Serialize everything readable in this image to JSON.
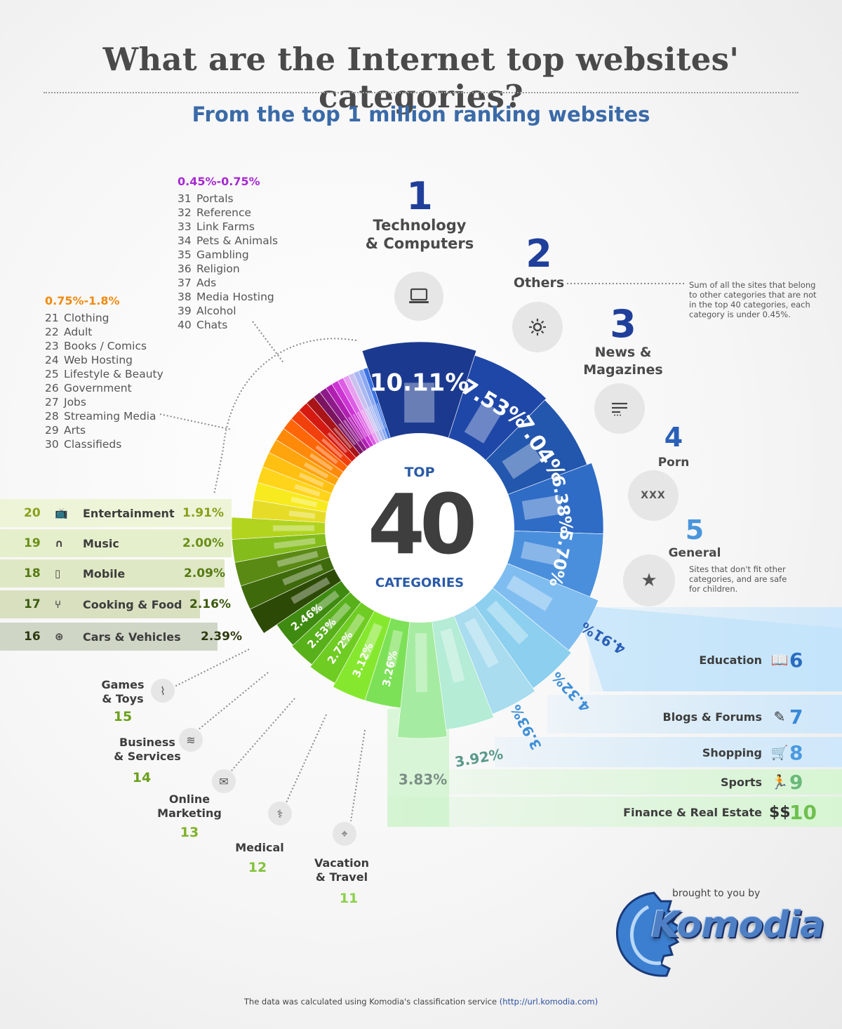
{
  "title": "What are the Internet top websites' categories?",
  "subtitle": "From the top 1 million ranking websites",
  "center": {
    "top": "TOP",
    "number": "40",
    "bottom": "CATEGORIES"
  },
  "top5": [
    {
      "rank": "1",
      "label_lines": [
        "Technology",
        "& Computers"
      ],
      "icon": "laptop-icon"
    },
    {
      "rank": "2",
      "label_lines": [
        "Others"
      ],
      "icon": "gear-icon",
      "note_lines": [
        "Sum of all the sites that belong",
        "to other categories that are not",
        "in the top 40 categories, each",
        "category is under 0.45%."
      ]
    },
    {
      "rank": "3",
      "label_lines": [
        "News &",
        "Magazines"
      ],
      "icon": "lines-icon"
    },
    {
      "rank": "4",
      "label_lines": [
        "Porn"
      ],
      "icon": "xxx-icon",
      "icon_text": "XXX"
    },
    {
      "rank": "5",
      "label_lines": [
        "General"
      ],
      "icon": "star-icon",
      "note_lines": [
        "Sites that don't fit  other",
        "categories, and are safe",
        "for children."
      ]
    }
  ],
  "right_bands": [
    {
      "rank": "6",
      "label": "Education",
      "icon": "book-icon"
    },
    {
      "rank": "7",
      "label": "Blogs & Forums",
      "icon": "pen-icon"
    },
    {
      "rank": "8",
      "label": "Shopping",
      "icon": "cart-icon"
    },
    {
      "rank": "9",
      "label": "Sports",
      "icon": "runner-icon"
    },
    {
      "rank": "10",
      "label": "Finance & Real Estate",
      "icon": "dollar-icon",
      "icon_text": "$$"
    }
  ],
  "left_bands": [
    {
      "rank": "20",
      "label": "Entertainment",
      "value": "1.91%",
      "icon": "tv-icon"
    },
    {
      "rank": "19",
      "label": "Music",
      "value": "2.00%",
      "icon": "headphones-icon"
    },
    {
      "rank": "18",
      "label": "Mobile",
      "value": "2.09%",
      "icon": "phone-icon"
    },
    {
      "rank": "17",
      "label": "Cooking & Food",
      "value": "2.16%",
      "icon": "utensils-icon"
    },
    {
      "rank": "16",
      "label": "Cars & Vehicles",
      "value": "2.39%",
      "icon": "wheel-icon"
    }
  ],
  "small_cats": [
    {
      "rank": "15",
      "label_lines": [
        "Games",
        "& Toys"
      ],
      "icon": "controller-icon"
    },
    {
      "rank": "14",
      "label_lines": [
        "Business",
        "& Services"
      ],
      "icon": "coins-icon"
    },
    {
      "rank": "13",
      "label_lines": [
        "Online",
        "Marketing"
      ],
      "icon": "mail-icon"
    },
    {
      "rank": "12",
      "label_lines": [
        "Medical"
      ],
      "icon": "caduceus-icon"
    },
    {
      "rank": "11",
      "label_lines": [
        "Vacation",
        "& Travel"
      ],
      "icon": "pin-icon"
    }
  ],
  "range_groups": [
    {
      "title": "0.75%-1.8%",
      "color": "#f08a10",
      "items": [
        [
          "21",
          "Clothing"
        ],
        [
          "22",
          "Adult"
        ],
        [
          "23",
          "Books / Comics"
        ],
        [
          "24",
          "Web Hosting"
        ],
        [
          "25",
          "Lifestyle & Beauty"
        ],
        [
          "26",
          "Government"
        ],
        [
          "27",
          "Jobs"
        ],
        [
          "28",
          "Streaming Media"
        ],
        [
          "29",
          "Arts"
        ],
        [
          "30",
          "Classifieds"
        ]
      ]
    },
    {
      "title": "0.45%-0.75%",
      "color": "#a62ad0",
      "items": [
        [
          "31",
          "Portals"
        ],
        [
          "32",
          "Reference"
        ],
        [
          "33",
          "Link Farms"
        ],
        [
          "34",
          "Pets & Animals"
        ],
        [
          "35",
          "Gambling"
        ],
        [
          "36",
          "Religion"
        ],
        [
          "37",
          "Ads"
        ],
        [
          "38",
          "Media Hosting"
        ],
        [
          "39",
          "Alcohol"
        ],
        [
          "40",
          "Chats"
        ]
      ]
    }
  ],
  "brand": {
    "brought": "brought to you by",
    "name": "Komodia"
  },
  "footer": {
    "text": "The data was calculated using Komodia's classification service ",
    "link": "(http://url.komodia.com)"
  },
  "chart_data": {
    "type": "pie",
    "title": "What are the Internet top websites' categories?",
    "subtitle": "From the top 1 million ranking websites",
    "slices": [
      {
        "rank": 1,
        "label": "Technology & Computers",
        "value": 10.11,
        "value_label": "10.11%",
        "color": "#1b3a8f"
      },
      {
        "rank": 2,
        "label": "Others",
        "value": 7.53,
        "value_label": "7.53%",
        "color": "#1f47a8"
      },
      {
        "rank": 3,
        "label": "News & Magazines",
        "value": 7.04,
        "value_label": "7.04%",
        "color": "#2356ad"
      },
      {
        "rank": 4,
        "label": "Porn",
        "value": 6.38,
        "value_label": "6.38%",
        "color": "#2f6cc6"
      },
      {
        "rank": 5,
        "label": "General",
        "value": 5.7,
        "value_label": "5.70%",
        "color": "#4a8fdc"
      },
      {
        "rank": 6,
        "label": "Education",
        "value": 4.91,
        "value_label": "4.91%",
        "color": "#7fbdf0"
      },
      {
        "rank": 7,
        "label": "Blogs & Forums",
        "value": 4.32,
        "value_label": "4.32%",
        "color": "#8ccfee"
      },
      {
        "rank": 8,
        "label": "Shopping",
        "value": 3.93,
        "value_label": "3.93%",
        "color": "#a8dcee"
      },
      {
        "rank": 9,
        "label": "Sports",
        "value": 3.92,
        "value_label": "3.92%",
        "color": "#b4ecd6"
      },
      {
        "rank": 10,
        "label": "Finance & Real Estate",
        "value": 3.83,
        "value_label": "3.83%",
        "color": "#a6eba2"
      },
      {
        "rank": 11,
        "label": "Vacation & Travel",
        "value": 3.26,
        "value_label": "3.26%",
        "color": "#7de158"
      },
      {
        "rank": 12,
        "label": "Medical",
        "value": 3.12,
        "value_label": "3.12%",
        "color": "#86e82e"
      },
      {
        "rank": 13,
        "label": "Online Marketing",
        "value": 2.72,
        "value_label": "2.72%",
        "color": "#6fcc22"
      },
      {
        "rank": 14,
        "label": "Business & Services",
        "value": 2.53,
        "value_label": "2.53%",
        "color": "#58b01b"
      },
      {
        "rank": 15,
        "label": "Games & Toys",
        "value": 2.46,
        "value_label": "2.46%",
        "color": "#3f8a10"
      },
      {
        "rank": 16,
        "label": "Cars & Vehicles",
        "value": 2.39,
        "value_label": "2.39%",
        "color": "#2c4a06"
      },
      {
        "rank": 17,
        "label": "Cooking & Food",
        "value": 2.16,
        "value_label": "2.16%",
        "color": "#3f6a0c"
      },
      {
        "rank": 18,
        "label": "Mobile",
        "value": 2.09,
        "value_label": "2.09%",
        "color": "#5a8a14"
      },
      {
        "rank": 19,
        "label": "Music",
        "value": 2.0,
        "value_label": "2.00%",
        "color": "#84bc1c"
      },
      {
        "rank": 20,
        "label": "Entertainment",
        "value": 1.91,
        "value_label": "1.91%",
        "color": "#b2d41e"
      },
      {
        "rank": 21,
        "label": "Clothing",
        "value": 1.8,
        "color": "#e6dc28"
      },
      {
        "rank": 22,
        "label": "Adult",
        "value": 1.7,
        "color": "#f7ea1e"
      },
      {
        "rank": 23,
        "label": "Books / Comics",
        "value": 1.6,
        "color": "#ffd41a"
      },
      {
        "rank": 24,
        "label": "Web Hosting",
        "value": 1.5,
        "color": "#ffc012"
      },
      {
        "rank": 25,
        "label": "Lifestyle & Beauty",
        "value": 1.4,
        "color": "#ffa40c"
      },
      {
        "rank": 26,
        "label": "Government",
        "value": 1.3,
        "color": "#ff8a0a"
      },
      {
        "rank": 27,
        "label": "Jobs",
        "value": 1.2,
        "color": "#ff6608"
      },
      {
        "rank": 28,
        "label": "Streaming Media",
        "value": 1.1,
        "color": "#f2400c"
      },
      {
        "rank": 29,
        "label": "Arts",
        "value": 1.0,
        "color": "#d51a12"
      },
      {
        "rank": 30,
        "label": "Classifieds",
        "value": 0.9,
        "color": "#a81418"
      },
      {
        "rank": 31,
        "label": "Portals",
        "value": 0.75,
        "color": "#7a1460"
      },
      {
        "rank": 32,
        "label": "Reference",
        "value": 0.72,
        "color": "#8e1a8a"
      },
      {
        "rank": 33,
        "label": "Link Farms",
        "value": 0.68,
        "color": "#b11fb2"
      },
      {
        "rank": 34,
        "label": "Pets & Animals",
        "value": 0.64,
        "color": "#cc34d4"
      },
      {
        "rank": 35,
        "label": "Gambling",
        "value": 0.6,
        "color": "#dd5ee4"
      },
      {
        "rank": 36,
        "label": "Religion",
        "value": 0.57,
        "color": "#e89ff0"
      },
      {
        "rank": 37,
        "label": "Ads",
        "value": 0.54,
        "color": "#c9c2ef"
      },
      {
        "rank": 38,
        "label": "Media Hosting",
        "value": 0.51,
        "color": "#a9b8f2"
      },
      {
        "rank": 39,
        "label": "Alcohol",
        "value": 0.48,
        "color": "#8aa8f2"
      },
      {
        "rank": 40,
        "label": "Chats",
        "value": 0.45,
        "color": "#3a72e2"
      }
    ]
  }
}
